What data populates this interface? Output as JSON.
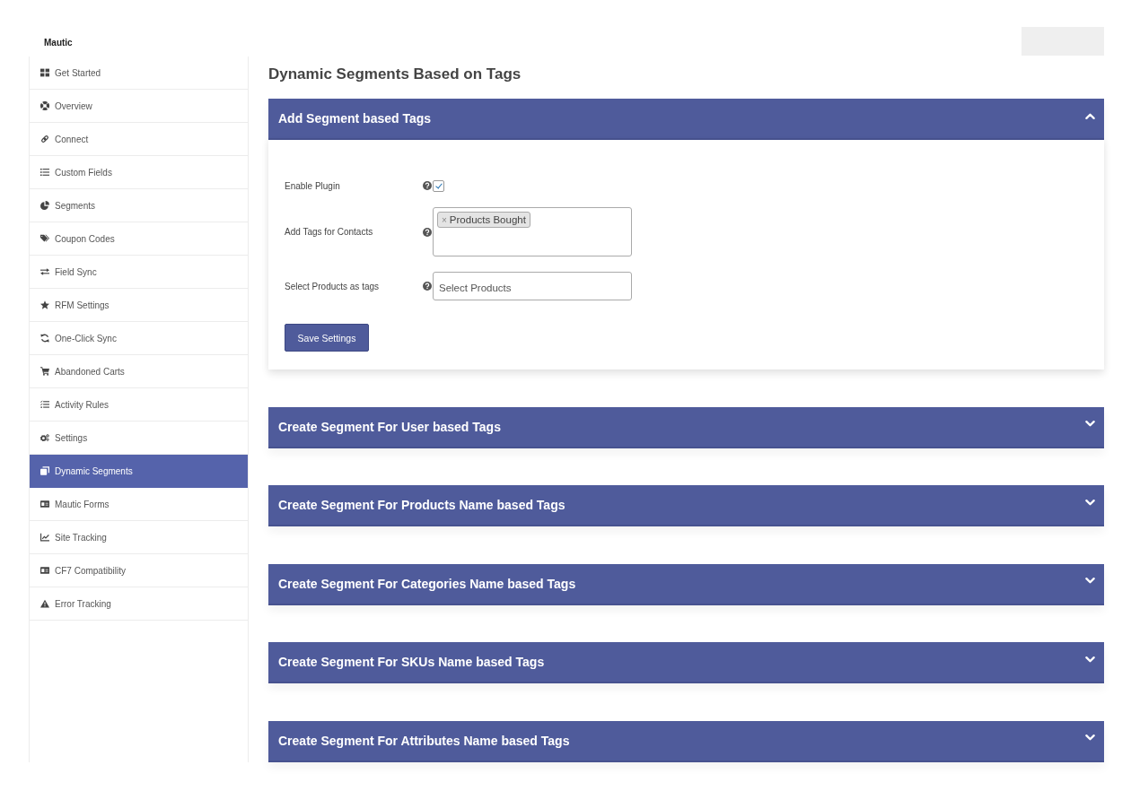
{
  "brand": "Mautic",
  "sidebar": {
    "items": [
      {
        "label": "Get Started",
        "selected": false
      },
      {
        "label": "Overview",
        "selected": false
      },
      {
        "label": "Connect",
        "selected": false
      },
      {
        "label": "Custom Fields",
        "selected": false
      },
      {
        "label": "Segments",
        "selected": false
      },
      {
        "label": "Coupon Codes",
        "selected": false
      },
      {
        "label": "Field Sync",
        "selected": false
      },
      {
        "label": "RFM Settings",
        "selected": false
      },
      {
        "label": "One-Click Sync",
        "selected": false
      },
      {
        "label": "Abandoned Carts",
        "selected": false
      },
      {
        "label": "Activity Rules",
        "selected": false
      },
      {
        "label": "Settings",
        "selected": false
      },
      {
        "label": "Dynamic Segments",
        "selected": true
      },
      {
        "label": "Mautic Forms",
        "selected": false
      },
      {
        "label": "Site Tracking",
        "selected": false
      },
      {
        "label": "CF7 Compatibility",
        "selected": false
      },
      {
        "label": "Error Tracking",
        "selected": false
      }
    ]
  },
  "page_title": "Dynamic Segments Based on Tags",
  "panels": [
    {
      "title": "Add Segment based Tags",
      "expanded": true,
      "fields": [
        {
          "kind": "checkbox",
          "label": "Enable Plugin",
          "checked": true
        },
        {
          "kind": "tags",
          "label": "Add Tags for Contacts",
          "tags": [
            {
              "remove": "×",
              "label": "Products Bought"
            }
          ]
        },
        {
          "kind": "select",
          "label": "Select Products as tags",
          "placeholder": "Select Products"
        }
      ],
      "button": "Save Settings"
    },
    {
      "title": "Create Segment For User based Tags",
      "expanded": false
    },
    {
      "title": "Create Segment For Products Name based Tags",
      "expanded": false
    },
    {
      "title": "Create Segment For Categories Name based Tags",
      "expanded": false
    },
    {
      "title": "Create Segment For SKUs Name based Tags",
      "expanded": false
    },
    {
      "title": "Create Segment For Attributes Name based Tags",
      "expanded": false
    }
  ]
}
